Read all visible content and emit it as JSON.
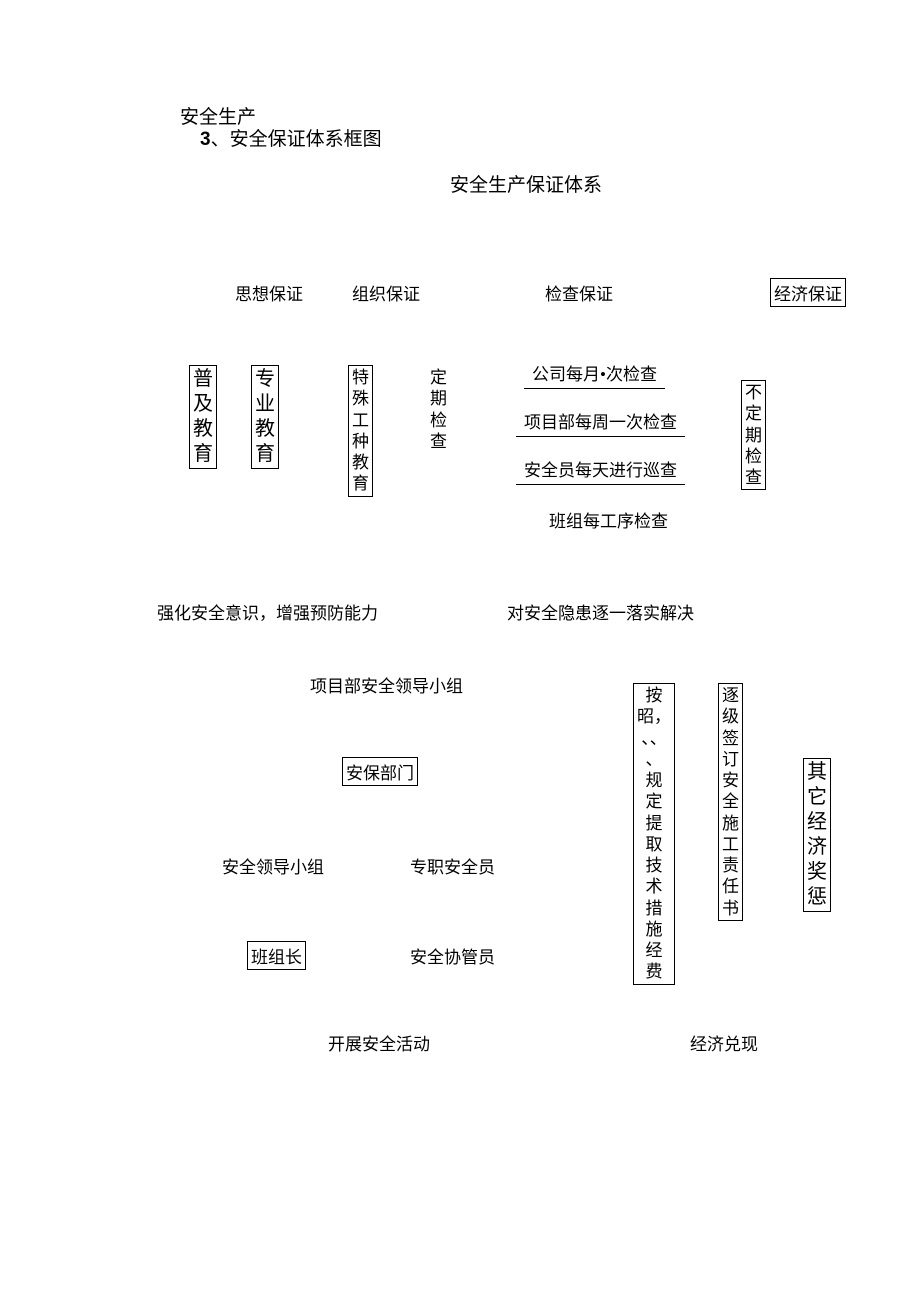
{
  "pre_title": "安全生产",
  "heading_num": "3",
  "heading_sep": "、",
  "heading_txt": "安全保证体系框图",
  "center_title": "安全生产保证体系",
  "tier1": {
    "sixiang": "思想保证",
    "zuzhi": "组织保证",
    "jiancha": "检查保证",
    "jingji": "经济保证"
  },
  "sixiang_children": {
    "puji": "普及教育",
    "zhuanye": "专业教育"
  },
  "zuzhi_children": {
    "teshu": "特殊工种教育",
    "dingqi": "定期检查"
  },
  "jiancha_list": [
    "公司每月•次检查",
    "项目部每周一次检查",
    "安全员每天进行巡查",
    "班组每工序检查"
  ],
  "budingqi": "不定期检查",
  "summary_left": "强化安全意识，增强预防能力",
  "summary_right": "对安全隐患逐一落实解决",
  "org": {
    "top": "项目部安全领导小组",
    "dept": "安保部门",
    "group": "安全领导小组",
    "fulltime": "专职安全员",
    "leader": "班组长",
    "assist": "安全协管员"
  },
  "vcol1": "按昭，、、、规定提取技术措施经费",
  "vcol2": "逐级签订安全施工责任书",
  "vcol3": "其它经济奖惩",
  "bottom_left": "开展安全活动",
  "bottom_right": "经济兑现"
}
